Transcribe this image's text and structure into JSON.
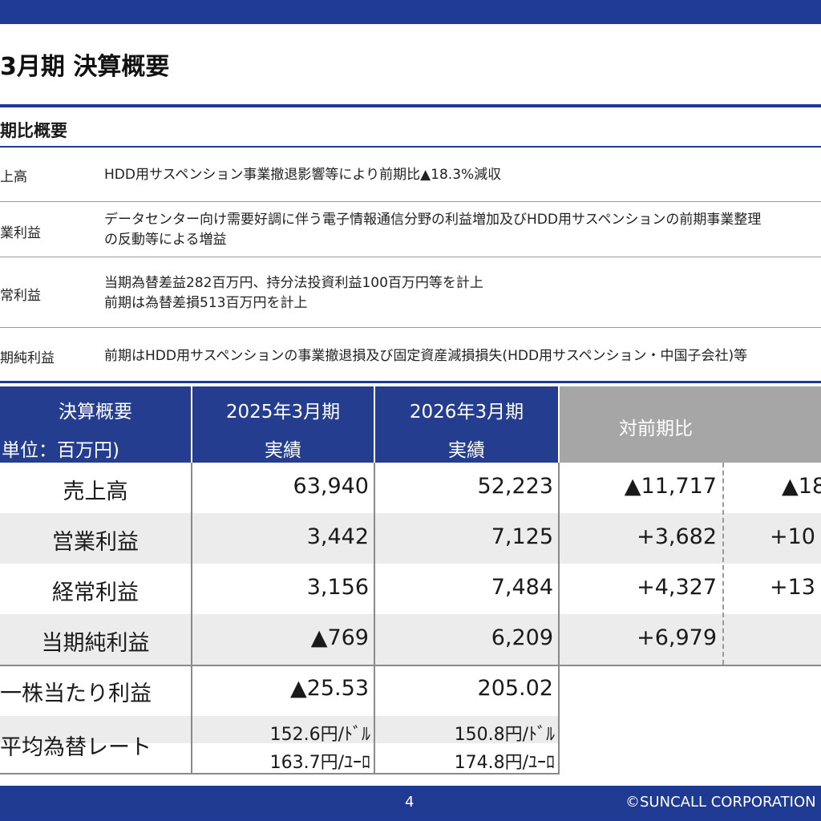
{
  "slide": {
    "title": "3月期 決算概要",
    "section_heading": "期比概要",
    "page_number": "4",
    "copyright": "©SUNCALL CORPORATION"
  },
  "notes": [
    {
      "label": "上高",
      "lines": [
        "HDD用サスペンション事業撤退影響等により前期比▲18.3%減収"
      ]
    },
    {
      "label": "業利益",
      "lines": [
        "データセンター向け需要好調に伴う電子情報通信分野の利益増加及びHDD用サスペンションの前期事業整理",
        "の反動等による増益"
      ]
    },
    {
      "label": "常利益",
      "lines": [
        "当期為替差益282百万円、持分法投資利益100百万円等を計上",
        "前期は為替差損513百万円を計上"
      ]
    },
    {
      "label": "期純利益",
      "lines": [
        "前期はHDD用サスペンションの事業撤退損及び固定資産減損損失(HDD用サスペンション・中国子会社)等"
      ]
    }
  ],
  "table": {
    "header": {
      "col0_line1": "決算概要",
      "col0_line2": "単位：百万円)",
      "col1_line1": "2025年3月期",
      "col1_line2": "実績",
      "col2_line1": "2026年3月期",
      "col2_line2": "実績",
      "col3": "対前期比"
    },
    "rows": [
      {
        "label": "売上高",
        "fy2025": "63,940",
        "fy2026": "52,223",
        "diff": "▲11,717",
        "pct": "▲18"
      },
      {
        "label": "営業利益",
        "fy2025": "3,442",
        "fy2026": "7,125",
        "diff": "+3,682",
        "pct": "+10"
      },
      {
        "label": "経常利益",
        "fy2025": "3,156",
        "fy2026": "7,484",
        "diff": "+4,327",
        "pct": "+13"
      },
      {
        "label": "当期純利益",
        "fy2025": "▲769",
        "fy2026": "6,209",
        "diff": "+6,979",
        "pct": ""
      }
    ],
    "eps": {
      "label": "一株当たり利益",
      "fy2025": "▲25.53",
      "fy2026": "205.02"
    },
    "fx": {
      "label": "平均為替レート",
      "fy2025_usd": "152.6円/ﾄﾞﾙ",
      "fy2025_eur": "163.7円/ﾕｰﾛ",
      "fy2026_usd": "150.8円/ﾄﾞﾙ",
      "fy2026_eur": "174.8円/ﾕｰﾛ"
    }
  },
  "colors": {
    "navy": "#1f3a93",
    "header_gray": "#a6a6a6",
    "band_gray": "#ececec"
  }
}
